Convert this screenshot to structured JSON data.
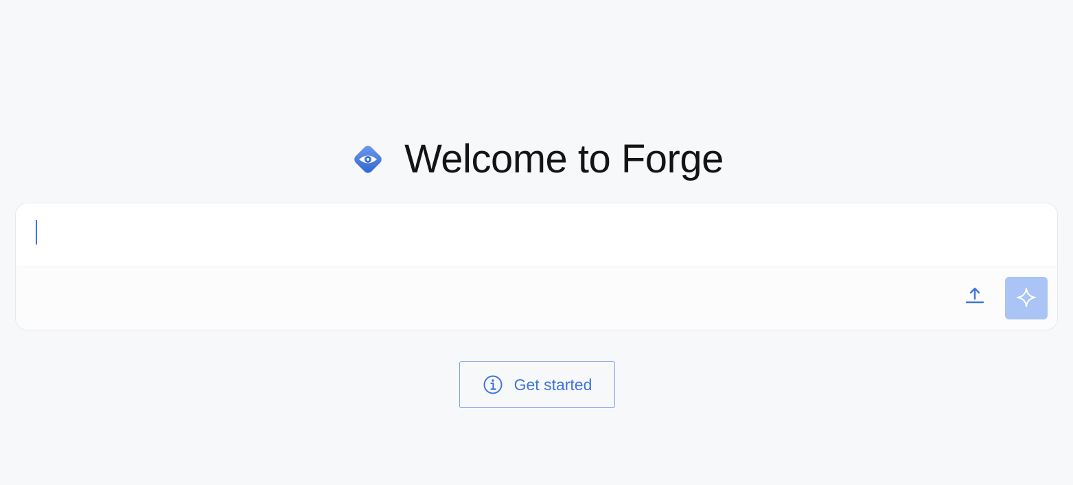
{
  "header": {
    "logo_icon": "eye-diamond-logo-icon",
    "title": "Welcome to Forge"
  },
  "composer": {
    "input_value": "",
    "input_placeholder": "",
    "upload_icon": "upload-icon",
    "submit_icon": "sparkle-icon"
  },
  "actions": {
    "get_started_label": "Get started",
    "get_started_icon": "info-icon"
  },
  "colors": {
    "accent": "#3d74de",
    "submit_bg": "#a9c4f5",
    "background": "#f7f8fa"
  }
}
